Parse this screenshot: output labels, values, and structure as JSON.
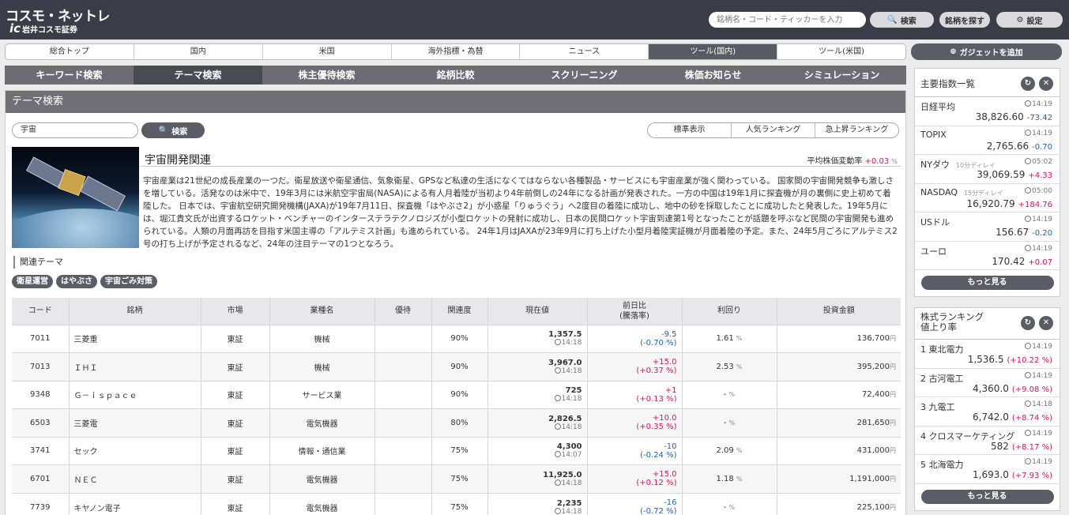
{
  "header": {
    "logo_main": "コスモ・ネットレ",
    "logo_mark": "ic",
    "logo_sub": "岩井コスモ証券",
    "search_placeholder": "銘柄名・コード・ティッカーを入力",
    "search_button": "検索",
    "find_button": "銘柄を探す",
    "settings_button": "設定"
  },
  "main_nav": {
    "items": [
      "総合トップ",
      "国内",
      "米国",
      "海外指標・為替",
      "ニュース",
      "ツール(国内)",
      "ツール(米国)"
    ],
    "active_index": 5,
    "add_gadget": "ガジェットを追加"
  },
  "sub_nav": {
    "items": [
      "キーワード検索",
      "テーマ検索",
      "株主優待検索",
      "銘柄比較",
      "スクリーニング",
      "株価お知らせ",
      "シミュレーション"
    ],
    "active_index": 1
  },
  "panel": {
    "title": "テーマ検索",
    "keyword": "宇宙",
    "search_button": "検索",
    "view_modes": [
      "標準表示",
      "人気ランキング",
      "急上昇ランキング"
    ],
    "theme_title": "宇宙開発関連",
    "avg_change_label": "平均株価変動率",
    "avg_change_value": "+0.03",
    "avg_change_unit": "%",
    "description": "宇宙産業は21世紀の成長産業の一つだ。衛星放送や衛星通信、気象衛星、GPSなど私達の生活になくてはならない各種製品・サービスにも宇宙産業が強く関わっている。 国家間の宇宙開発競争も激しさを増している。活発なのは米中で、19年3月には米航空宇宙局(NASA)による有人月着陸が当初より4年前倒しの24年になる計画が発表された。一方の中国は19年1月に探査機が月の裏側に史上初めて着陸した。 日本では、宇宙航空研究開発機構(JAXA)が19年7月11日、探査機「はやぶさ2」が小惑星「りゅうぐう」へ2度目の着陸に成功し、地中の砂を採取したことに成功したと発表した。19年5月には、堀江貴文氏が出資するロケット・ベンチャーのインターステラテクノロジズが小型ロケットの発射に成功し、日本の民間ロケット宇宙到達第1号となったことが話題を呼ぶなど民間の宇宙開発も進められている。人類の月面再訪を目指す米国主導の「アルテミス計画」も進められている。 24年1月はJAXAが23年9月に打ち上げた小型月着陸実証機が月面着陸の予定。また、24年5月ごろにアルテミス2号の打ち上げが予定されるなど、24年の注目テーマの1つとなろう。",
    "related_label": "関連テーマ",
    "related_tags": [
      "衛星運営",
      "はやぶさ",
      "宇宙ごみ対策"
    ]
  },
  "table": {
    "headers": {
      "code": "コード",
      "name": "銘柄",
      "market": "市場",
      "industry": "業種名",
      "benefit": "優待",
      "relevance": "関連度",
      "price": "現在値",
      "change": "前日比",
      "change_sub": "(騰落率)",
      "yield": "利回り",
      "investment": "投資金額"
    },
    "rows": [
      {
        "code": "7011",
        "name": "三菱重",
        "market": "東証",
        "industry": "機械",
        "benefit": "",
        "relevance": "90%",
        "price": "1,357.5",
        "time": "14:18",
        "change": "-9.5",
        "pct": "(-0.70 %)",
        "dir": "dn",
        "yield": "1.61",
        "yield_unit": "%",
        "investment": "136,700",
        "inv_unit": "円"
      },
      {
        "code": "7013",
        "name": "ＩＨＩ",
        "market": "東証",
        "industry": "機械",
        "benefit": "",
        "relevance": "90%",
        "price": "3,967.0",
        "time": "14:18",
        "change": "+15.0",
        "pct": "(+0.37 %)",
        "dir": "up",
        "yield": "2.53",
        "yield_unit": "%",
        "investment": "395,200",
        "inv_unit": "円"
      },
      {
        "code": "9348",
        "name": "Ｇ－ｉｓｐａｃｅ",
        "market": "東証",
        "industry": "サービス業",
        "benefit": "",
        "relevance": "90%",
        "price": "725",
        "time": "14:18",
        "change": "+1",
        "pct": "(+0.13 %)",
        "dir": "up",
        "yield": "-",
        "yield_unit": "%",
        "investment": "72,400",
        "inv_unit": "円"
      },
      {
        "code": "6503",
        "name": "三菱電",
        "market": "東証",
        "industry": "電気機器",
        "benefit": "",
        "relevance": "80%",
        "price": "2,826.5",
        "time": "14:18",
        "change": "+10.0",
        "pct": "(+0.35 %)",
        "dir": "up",
        "yield": "-",
        "yield_unit": "%",
        "investment": "281,650",
        "inv_unit": "円"
      },
      {
        "code": "3741",
        "name": "セック",
        "market": "東証",
        "industry": "情報・通信業",
        "benefit": "",
        "relevance": "75%",
        "price": "4,300",
        "time": "14:07",
        "change": "-10",
        "pct": "(-0.24 %)",
        "dir": "dn",
        "yield": "2.09",
        "yield_unit": "%",
        "investment": "431,000",
        "inv_unit": "円"
      },
      {
        "code": "6701",
        "name": "ＮＥＣ",
        "market": "東証",
        "industry": "電気機器",
        "benefit": "",
        "relevance": "75%",
        "price": "11,925.0",
        "time": "14:18",
        "change": "+15.0",
        "pct": "(+0.12 %)",
        "dir": "up",
        "yield": "1.18",
        "yield_unit": "%",
        "investment": "1,191,000",
        "inv_unit": "円"
      },
      {
        "code": "7739",
        "name": "キヤノン電子",
        "market": "東証",
        "industry": "電気機器",
        "benefit": "",
        "relevance": "75%",
        "price": "2,235",
        "time": "14:18",
        "change": "-16",
        "pct": "(-0.72 %)",
        "dir": "dn",
        "yield": "-",
        "yield_unit": "%",
        "investment": "225,100",
        "inv_unit": "円"
      }
    ]
  },
  "sidebar": {
    "indices": {
      "title": "主要指数一覧",
      "rows": [
        {
          "name": "日経平均",
          "delay": "",
          "time": "14:19",
          "value": "38,826.60",
          "change": "-73.42",
          "dir": "dn"
        },
        {
          "name": "TOPIX",
          "delay": "",
          "time": "14:19",
          "value": "2,765.66",
          "change": "-0.70",
          "dir": "dn"
        },
        {
          "name": "NYダウ",
          "delay": "10分ディレイ",
          "time": "05:02",
          "value": "39,069.59",
          "change": "+4.33",
          "dir": "up"
        },
        {
          "name": "NASDAQ",
          "delay": "15分ディレイ",
          "time": "05:00",
          "value": "16,920.79",
          "change": "+184.76",
          "dir": "up"
        },
        {
          "name": "USドル",
          "delay": "",
          "time": "14:19",
          "value": "156.67",
          "change": "-0.20",
          "dir": "dn"
        },
        {
          "name": "ユーロ",
          "delay": "",
          "time": "14:19",
          "value": "170.42",
          "change": "+0.07",
          "dir": "up"
        }
      ],
      "more": "もっと見る"
    },
    "ranking": {
      "title_line1": "株式ランキング",
      "title_line2": "値上り率",
      "rows": [
        {
          "name": "1 東北電力",
          "time": "14:19",
          "value": "1,536.5",
          "change": "(+10.22 %)"
        },
        {
          "name": "2 古河電工",
          "time": "14:19",
          "value": "4,360.0",
          "change": "(+9.08 %)"
        },
        {
          "name": "3 九電工",
          "time": "14:18",
          "value": "6,742.0",
          "change": "(+8.74 %)"
        },
        {
          "name": "4 クロスマーケティング",
          "time": "14:19",
          "value": "582",
          "change": "(+8.17 %)"
        },
        {
          "name": "5 北海電力",
          "time": "14:19",
          "value": "1,693.0",
          "change": "(+7.93 %)"
        }
      ],
      "more": "もっと見る"
    }
  },
  "colors": {
    "up": "#e0115f",
    "down": "#1f5fbf",
    "header_bg": "#3c3c48",
    "accent_dark": "#5c5c66"
  },
  "icons": {
    "search": "search-icon",
    "gear": "gear-icon",
    "plus": "plus-circle-icon",
    "refresh": "refresh-icon",
    "close": "close-icon",
    "clock": "clock-icon"
  }
}
